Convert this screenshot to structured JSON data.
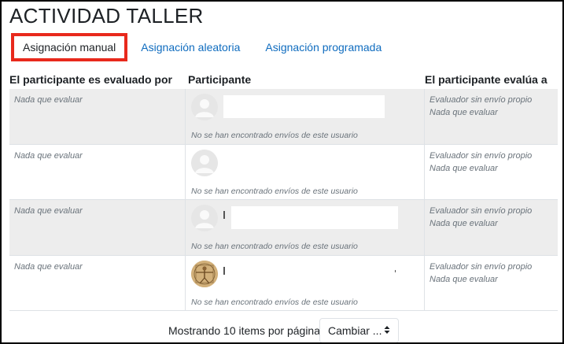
{
  "page": {
    "title": "ACTIVIDAD TALLER"
  },
  "tabs": [
    {
      "label": "Asignación manual",
      "active": true
    },
    {
      "label": "Asignación aleatoria",
      "active": false
    },
    {
      "label": "Asignación programada",
      "active": false
    }
  ],
  "table": {
    "headers": [
      "El participante es evaluado por",
      "Participante",
      "El participante evalúa a"
    ],
    "rows": [
      {
        "evaluated_by": "Nada que evaluar",
        "status": "No se han encontrado envíos de este usuario",
        "evaluates_1": "Evaluador sin envío propio",
        "evaluates_2": "Nada que evaluar",
        "avatar": "default-user-icon"
      },
      {
        "evaluated_by": "Nada que evaluar",
        "status": "No se han encontrado envíos de este usuario",
        "evaluates_1": "Evaluador sin envío propio",
        "evaluates_2": "Nada que evaluar",
        "avatar": "default-user-icon"
      },
      {
        "evaluated_by": "Nada que evaluar",
        "status": "No se han encontrado envíos de este usuario",
        "evaluates_1": "Evaluador sin envío propio",
        "evaluates_2": "Nada que evaluar",
        "avatar": "default-user-icon"
      },
      {
        "evaluated_by": "Nada que evaluar",
        "status": "No se han encontrado envíos de este usuario",
        "evaluates_1": "Evaluador sin envío propio",
        "evaluates_2": "Nada que evaluar",
        "avatar": "vitruvian-man-photo"
      }
    ]
  },
  "pagination": {
    "per_page_label": "Mostrando 10 items por página",
    "change_button": "Cambiar ...",
    "caret_icon": "updown-caret-icon"
  }
}
